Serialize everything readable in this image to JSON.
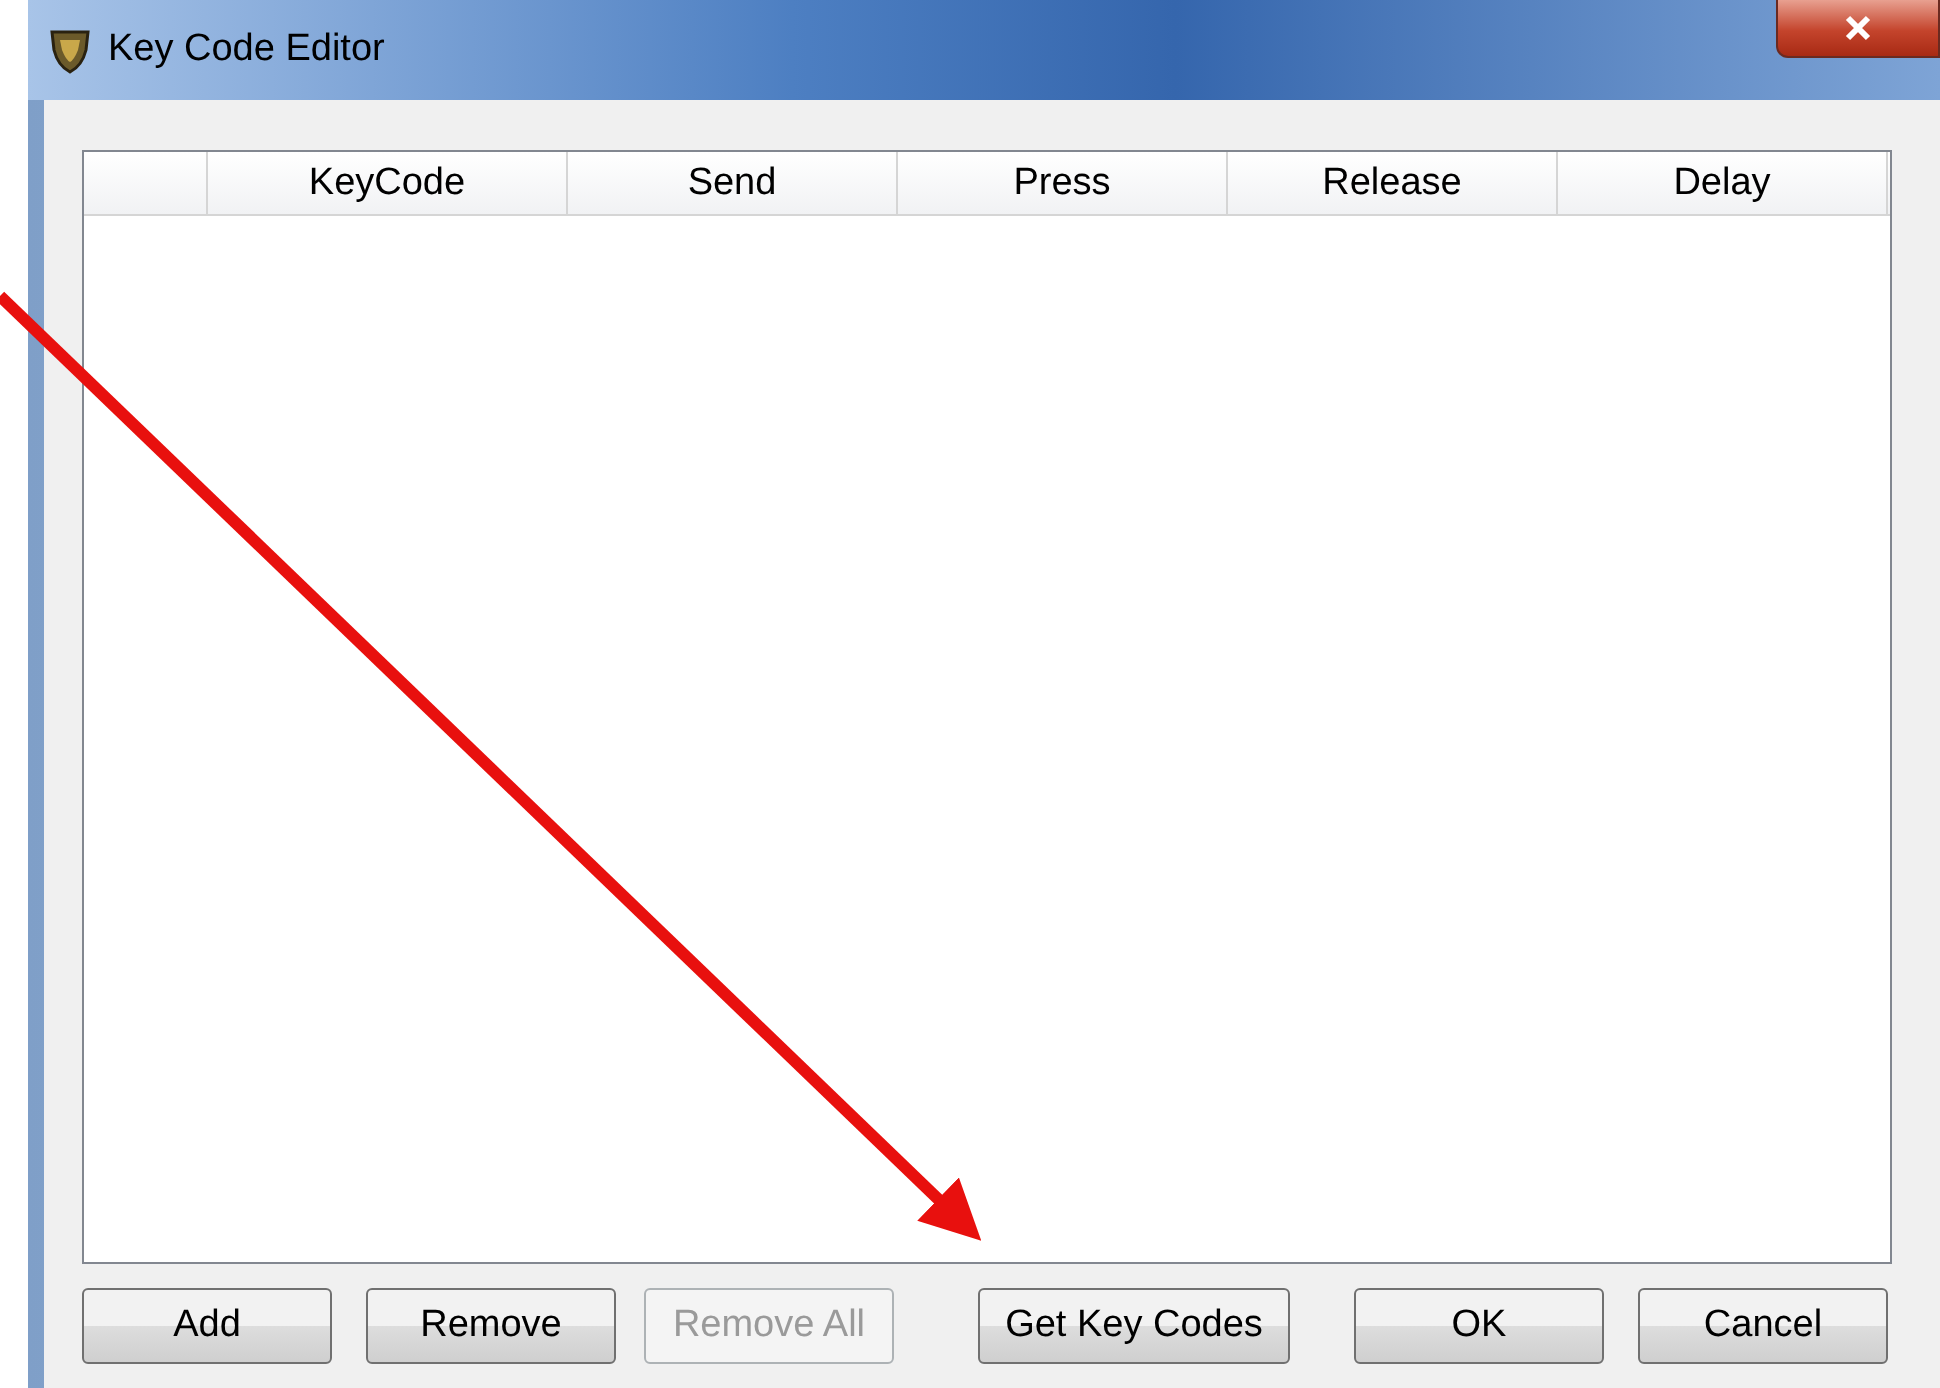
{
  "window": {
    "title": "Key Code Editor"
  },
  "table": {
    "columns": [
      "KeyCode",
      "Send",
      "Press",
      "Release",
      "Delay"
    ]
  },
  "buttons": [
    {
      "label": "Add",
      "disabled": false
    },
    {
      "label": "Remove",
      "disabled": false
    },
    {
      "label": "Remove All",
      "disabled": true
    },
    {
      "label": "Get Key Codes",
      "disabled": false
    },
    {
      "label": "OK",
      "disabled": false
    },
    {
      "label": "Cancel",
      "disabled": false
    }
  ]
}
